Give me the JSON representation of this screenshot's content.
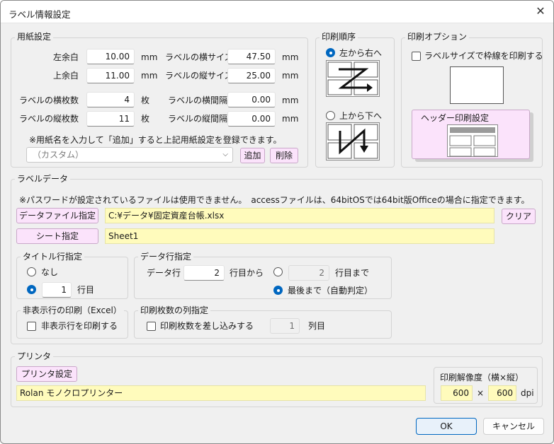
{
  "window": {
    "title": "ラベル情報設定",
    "close_glyph": "✕"
  },
  "paper": {
    "group_label": "用紙設定",
    "left_margin": {
      "label": "左余白",
      "value": "10.00",
      "unit": "mm"
    },
    "top_margin": {
      "label": "上余白",
      "value": "11.00",
      "unit": "mm"
    },
    "label_width": {
      "label": "ラベルの横サイズ",
      "value": "47.50",
      "unit": "mm"
    },
    "label_height": {
      "label": "ラベルの縦サイズ",
      "value": "25.00",
      "unit": "mm"
    },
    "cols": {
      "label": "ラベルの横枚数",
      "value": "4",
      "unit": "枚"
    },
    "rows": {
      "label": "ラベルの縦枚数",
      "value": "11",
      "unit": "枚"
    },
    "h_gap": {
      "label": "ラベルの横間隔",
      "value": "0.00",
      "unit": "mm"
    },
    "v_gap": {
      "label": "ラベルの縦間隔",
      "value": "0.00",
      "unit": "mm"
    },
    "note": "※用紙名を入力して「追加」すると上記用紙設定を登録できます。",
    "preset_value": "（カスタム）",
    "add_label": "追加",
    "delete_label": "削除"
  },
  "print_order": {
    "group_label": "印刷順序",
    "left_to_right": "左から右へ",
    "top_to_bottom": "上から下へ",
    "selected": "left_to_right"
  },
  "print_option": {
    "group_label": "印刷オプション",
    "border_label": "ラベルサイズで枠線を印刷する",
    "border_checked": false,
    "header_button": "ヘッダー印刷設定"
  },
  "label_data": {
    "group_label": "ラベルデータ",
    "note": "※パスワードが設定されているファイルは使用できません。　accessファイルは、64bitOSでは64bit版Officeの場合に指定できます。",
    "file_button": "データファイル指定",
    "file_path": "C:¥データ¥固定資産台帳.xlsx",
    "clear_button": "クリア",
    "sheet_button": "シート指定",
    "sheet_name": "Sheet1",
    "title_row": {
      "group_label": "タイトル行指定",
      "none_label": "なし",
      "row_value": "1",
      "row_unit": "行目",
      "selected": "row"
    },
    "data_row": {
      "group_label": "データ行指定",
      "label": "データ行",
      "start_value": "2",
      "start_suffix": "行目から",
      "end_value": "2",
      "end_suffix": "行目まで",
      "auto_label": "最後まで（自動判定）",
      "selected": "auto"
    },
    "hidden_rows": {
      "group_label": "非表示行の印刷（Excel）",
      "check_label": "非表示行を印刷する",
      "checked": false
    },
    "copies_col": {
      "group_label": "印刷枚数の列指定",
      "check_label": "印刷枚数を差し込みする",
      "checked": false,
      "col_value": "1",
      "col_unit": "列目"
    }
  },
  "printer": {
    "group_label": "プリンタ",
    "setup_button": "プリンタ設定",
    "name": "Rolan モノクロプリンター",
    "resolution": {
      "group_label": "印刷解像度（横×縦）",
      "h": "600",
      "times": "×",
      "v": "600",
      "unit": "dpi"
    }
  },
  "footer": {
    "ok": "OK",
    "cancel": "キャンセル"
  },
  "colors": {
    "input_yellow": "#fffbbc",
    "button_pink": "#fbe3fb",
    "accent": "#0067c0"
  }
}
